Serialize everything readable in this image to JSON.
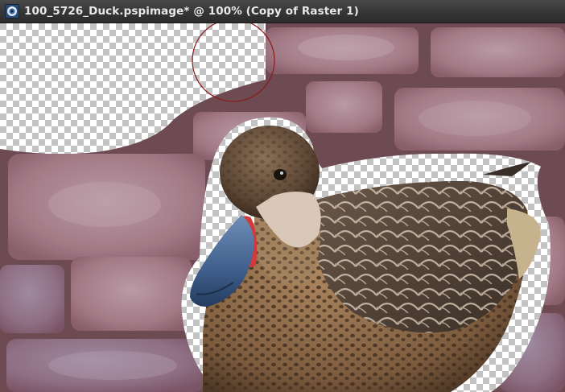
{
  "window": {
    "title": "100_5726_Duck.pspimage* @ 100% (Copy of Raster 1)",
    "app_icon": "paint-shop-pro-icon"
  },
  "canvas": {
    "image_subject": "duck-on-brick-pavement",
    "transparency_pattern": "checkerboard",
    "eraser_brush_cursor": "circle-outline"
  },
  "colors": {
    "titlebar": "#353535",
    "title_text": "#e8e8e8",
    "checker_light": "#ffffff",
    "checker_dark": "#c3c3c3",
    "brush_outline": "#8b1a1a",
    "brick": "#a77f8a",
    "mortar": "#6e4a53"
  }
}
